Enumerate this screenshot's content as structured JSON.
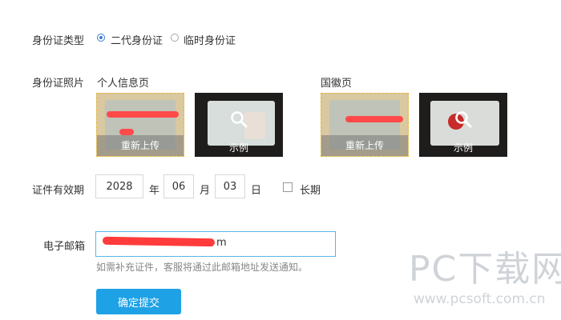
{
  "form": {
    "id_type": {
      "label": "身份证类型",
      "options": [
        {
          "label": "二代身份证",
          "selected": true
        },
        {
          "label": "临时身份证",
          "selected": false
        }
      ]
    },
    "id_photo": {
      "label": "身份证照片",
      "front": {
        "title": "个人信息页",
        "upload_label": "重新上传",
        "example_label": "示例"
      },
      "back": {
        "title": "国徽页",
        "upload_label": "重新上传",
        "example_label": "示例"
      }
    },
    "validity": {
      "label": "证件有效期",
      "year": "2028",
      "year_unit": "年",
      "month": "06",
      "month_unit": "月",
      "day": "03",
      "day_unit": "日",
      "long_term_label": "长期",
      "long_term_checked": false
    },
    "email": {
      "label": "电子邮箱",
      "value_visible_tail": "m",
      "hint": "如需补充证件，客服将通过此邮箱地址发送通知。"
    },
    "submit_label": "确定提交"
  },
  "watermark": {
    "brand": "PC下载网",
    "url": "www.pcsoft.com.cn"
  },
  "colors": {
    "accent": "#1fa1e6",
    "email_border": "#55b8e6",
    "redaction": "#ff3b3b",
    "upload_border": "#e6b93a"
  }
}
